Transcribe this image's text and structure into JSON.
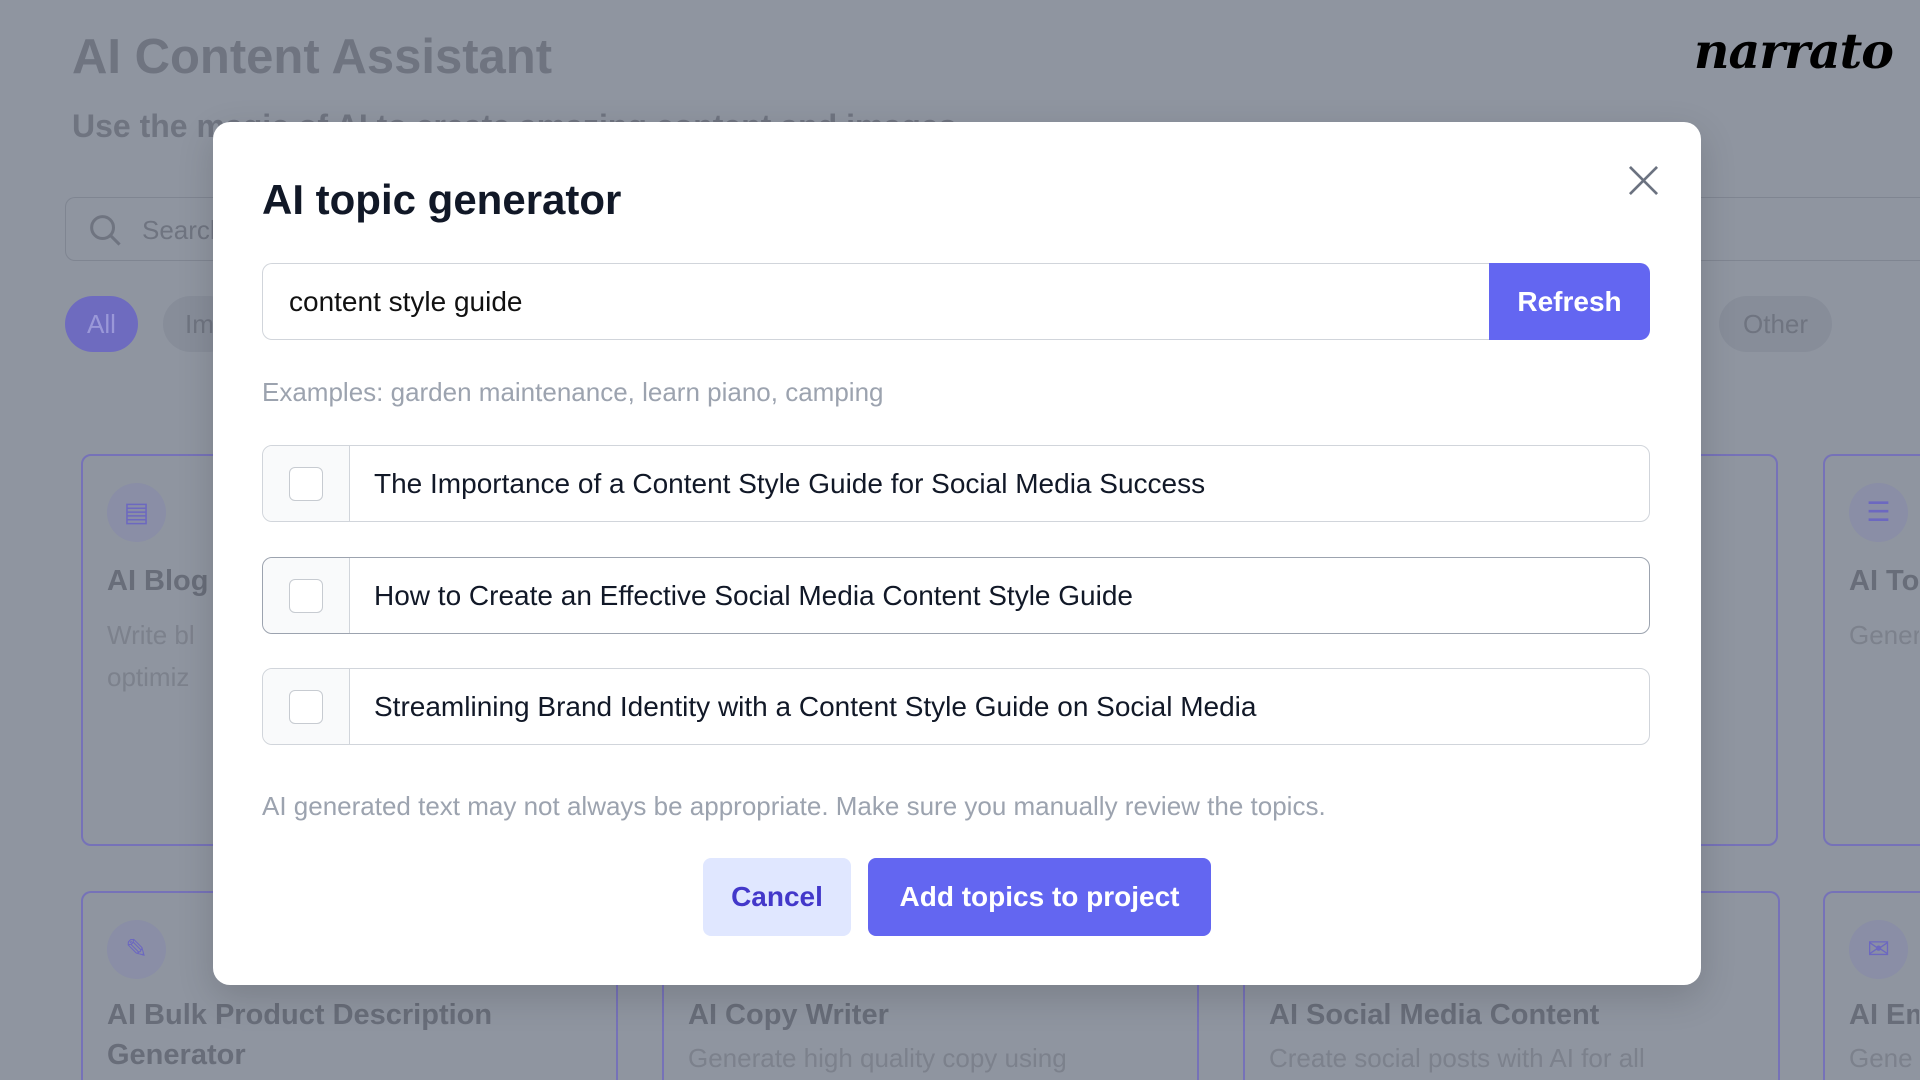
{
  "background": {
    "title": "AI Content Assistant",
    "subtitle": "Use the magic of AI to create amazing content and images",
    "logo": "narrato",
    "search_placeholder": "Search",
    "chips": [
      "All",
      "Im",
      "Other"
    ],
    "cards": [
      {
        "title": "AI Blog",
        "desc": [
          "Write bl",
          "optimiz"
        ],
        "icon": "document-icon"
      },
      {
        "title": "AI To",
        "desc": [
          "Gener"
        ],
        "icon": "list-icon"
      },
      {
        "title": "AI Bulk Product Description",
        "title2": "Generator",
        "icon": "edit-document-icon"
      },
      {
        "title": "AI Copy Writer",
        "desc": [
          "Generate high quality copy using"
        ]
      },
      {
        "title": "AI Social Media Content",
        "desc": [
          "Create social posts with AI for all"
        ]
      },
      {
        "title": "AI Em",
        "desc": [
          "Gene"
        ],
        "icon": "mail-icon"
      }
    ]
  },
  "modal": {
    "title": "AI topic generator",
    "input_value": "content style guide",
    "refresh_label": "Refresh",
    "examples": "Examples: garden maintenance, learn piano, camping",
    "topics": [
      {
        "label": "The Importance of a Content Style Guide for Social Media Success",
        "checked": false
      },
      {
        "label": "How to Create an Effective Social Media Content Style Guide",
        "checked": false
      },
      {
        "label": "Streamlining Brand Identity with a Content Style Guide on Social Media",
        "checked": false
      }
    ],
    "disclaimer": "AI generated text may not always be appropriate. Make sure you manually review the topics.",
    "cancel_label": "Cancel",
    "add_label": "Add topics to project"
  },
  "colors": {
    "accent": "#6366f1",
    "overlay": "#8f95a0",
    "cancel_bg": "#e0e7ff"
  }
}
